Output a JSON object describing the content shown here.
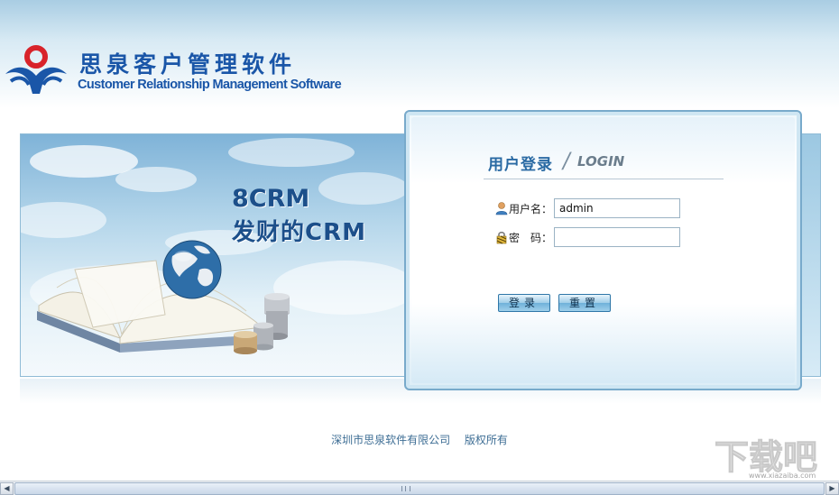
{
  "brand": {
    "name_cn": "思泉客户管理软件",
    "name_en": "Customer Relationship Management Software",
    "logo_icon": "company-logo-icon"
  },
  "banner": {
    "slogan_1": "8CRM",
    "slogan_2": "发财的CRM"
  },
  "login": {
    "title": "用户登录",
    "title_en": "LOGIN",
    "username_label": "用户名：",
    "username_value": "admin",
    "password_label": "密　码：",
    "password_value": "",
    "login_button": "登录",
    "reset_button": "重置",
    "username_icon": "user-icon",
    "password_icon": "lock-icon"
  },
  "footer": {
    "company": "深圳市思泉软件有限公司",
    "rights": "版权所有"
  },
  "watermark": {
    "text": "下载吧",
    "site": "www.xiazaiba.com"
  },
  "colors": {
    "brand_blue": "#1a56a8",
    "brand_red": "#d8232a",
    "title_blue": "#2a6aa3",
    "footer_blue": "#3e6e95"
  }
}
